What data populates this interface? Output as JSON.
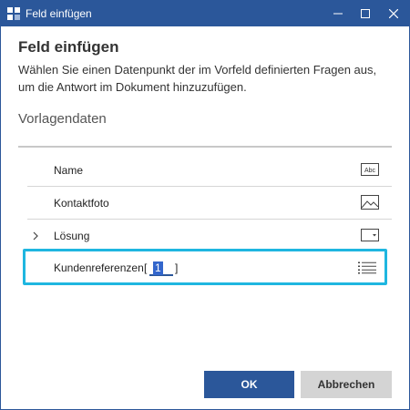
{
  "window": {
    "title": "Feld einfügen"
  },
  "dialog": {
    "heading": "Feld einfügen",
    "description": "Wählen Sie einen Datenpunkt der im Vorfeld definierten Fragen aus, um die Antwort im Dokument hinzuzufügen.",
    "section_title": "Vorlagendaten"
  },
  "fields": [
    {
      "label": "Name",
      "icon": "text-field-icon",
      "icon_text": "Abc"
    },
    {
      "label": "Kontaktfoto",
      "icon": "image-icon"
    },
    {
      "label": "Lösung",
      "icon": "dropdown-field-icon",
      "expandable": true
    },
    {
      "label": "Kundenreferenzen",
      "icon": "list-icon",
      "index_value": "1",
      "bracket_open": "[",
      "bracket_close": "]"
    }
  ],
  "buttons": {
    "ok": "OK",
    "cancel": "Abbrechen"
  },
  "colors": {
    "accent": "#2b579a",
    "focus": "#1fb6e0"
  }
}
